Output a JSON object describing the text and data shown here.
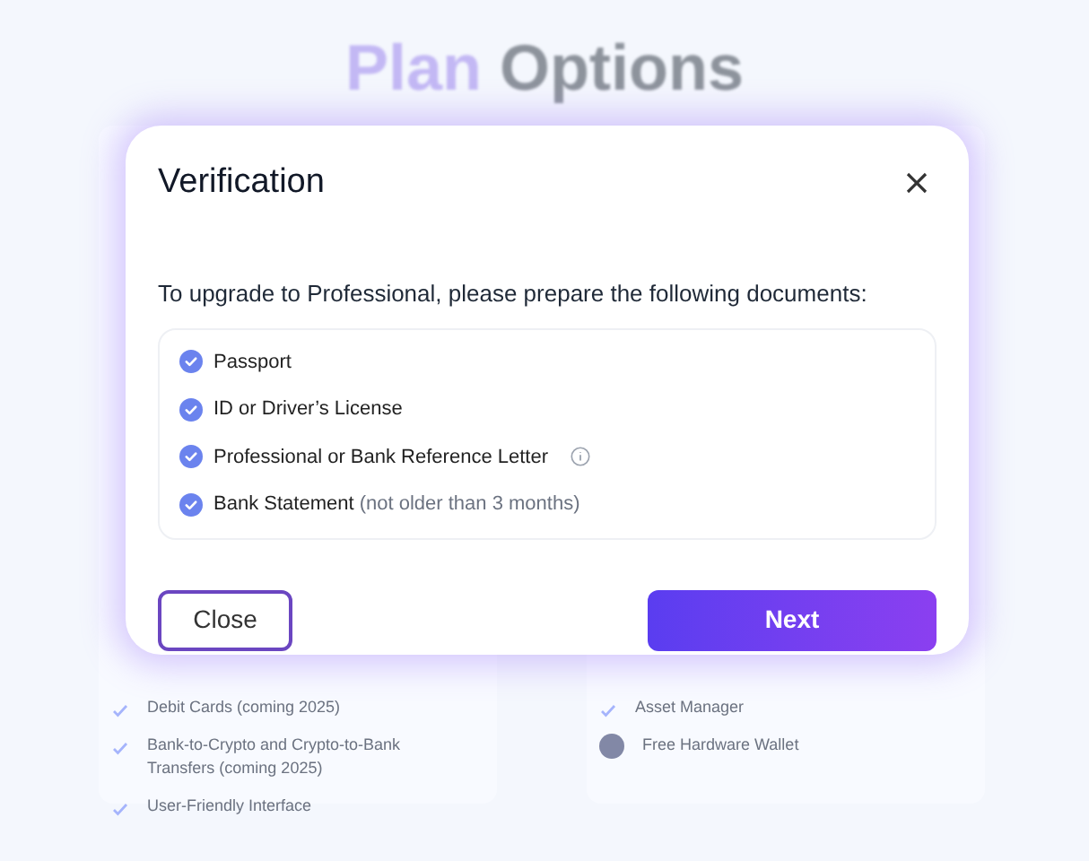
{
  "page_title": {
    "accent": "Plan",
    "rest": "Options"
  },
  "background_cards": [
    {
      "features": [
        {
          "kind": "check",
          "label": "Debit Cards (coming 2025)"
        },
        {
          "kind": "check",
          "label": "Bank-to-Crypto and Crypto-to-Bank Transfers (coming 2025)"
        },
        {
          "kind": "check",
          "label": "User-Friendly Interface"
        }
      ]
    },
    {
      "features": [
        {
          "kind": "check",
          "label": "Asset Manager"
        },
        {
          "kind": "badge",
          "label": "Free Hardware Wallet"
        }
      ]
    }
  ],
  "dialog": {
    "title": "Verification",
    "intro": "To upgrade to Professional, please prepare the following documents:",
    "documents": [
      {
        "label": "Passport",
        "checked": true,
        "info": false
      },
      {
        "label": "ID or Driver’s License",
        "checked": true,
        "info": false
      },
      {
        "label": "Professional or Bank Reference Letter",
        "checked": true,
        "info": true
      },
      {
        "label": "Bank Statement",
        "note": "(not older than 3 months)",
        "checked": true,
        "info": false
      }
    ],
    "buttons": {
      "secondary": "Close",
      "primary": "Next"
    }
  }
}
